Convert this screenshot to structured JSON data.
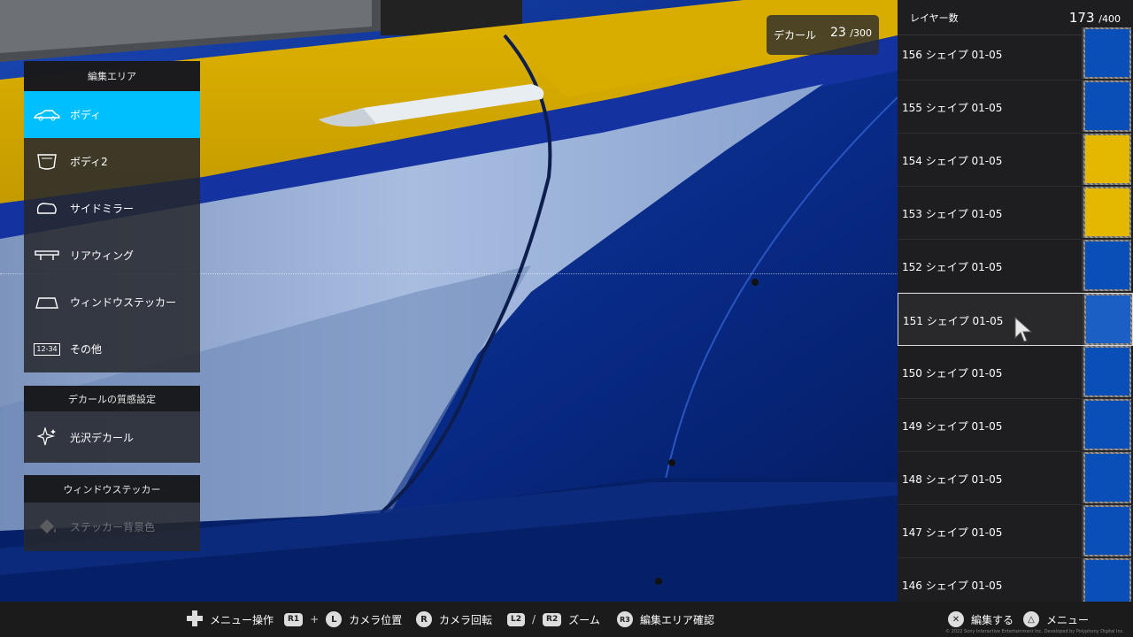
{
  "edit_area": {
    "title": "編集エリア",
    "items": [
      {
        "label": "ボディ",
        "icon": "car-body-icon",
        "active": true
      },
      {
        "label": "ボディ2",
        "icon": "body2-icon"
      },
      {
        "label": "サイドミラー",
        "icon": "side-mirror-icon"
      },
      {
        "label": "リアウィング",
        "icon": "rear-wing-icon"
      },
      {
        "label": "ウィンドウステッカー",
        "icon": "windshield-icon"
      },
      {
        "label": "その他",
        "icon": "license-plate-icon",
        "plate_text": "12-34"
      }
    ]
  },
  "decal_texture": {
    "title": "デカールの質感設定",
    "item": {
      "label": "光沢デカール",
      "icon": "sparkle-icon"
    }
  },
  "window_sticker": {
    "title": "ウィンドウステッカー",
    "item": {
      "label": "ステッカー背景色",
      "icon": "paint-bucket-icon",
      "disabled": true
    }
  },
  "decal_count": {
    "label": "デカール",
    "value": "23",
    "max": "/300"
  },
  "layers": {
    "label": "レイヤー数",
    "count": "173",
    "max": "/400",
    "rows": [
      {
        "name": "156 シェイプ 01-05",
        "color": "#0a4fb8"
      },
      {
        "name": "155 シェイプ 01-05",
        "color": "#0a4fb8"
      },
      {
        "name": "154 シェイプ 01-05",
        "color": "#e5b800"
      },
      {
        "name": "153 シェイプ 01-05",
        "color": "#e5b800"
      },
      {
        "name": "152 シェイプ 01-05",
        "color": "#0a4fb8"
      },
      {
        "name": "151 シェイプ 01-05",
        "color": "#1b5fc4",
        "selected": true
      },
      {
        "name": "150 シェイプ 01-05",
        "color": "#0a4fb8"
      },
      {
        "name": "149 シェイプ 01-05",
        "color": "#0a4fb8"
      },
      {
        "name": "148 シェイプ 01-05",
        "color": "#0a4fb8"
      },
      {
        "name": "147 シェイプ 01-05",
        "color": "#0a4fb8"
      },
      {
        "name": "146 シェイプ 01-05",
        "color": "#0a4fb8"
      }
    ]
  },
  "bottom_bar": {
    "menu_op": "メニュー操作",
    "r1": "R1",
    "plus": "+",
    "l": "L",
    "camera_pos": "カメラ位置",
    "r": "R",
    "camera_rot": "カメラ回転",
    "l2": "L2",
    "slash": "/",
    "r2": "R2",
    "zoom": "ズーム",
    "r3": "R3",
    "edit_area_check": "編集エリア確認",
    "edit": "編集する",
    "menu": "メニュー",
    "copyright": "© 2022 Sony Interactive Entertainment Inc. Developed by Polyphony Digital Inc."
  },
  "colors": {
    "accent": "#00bfff",
    "car_blue": "#0a2f8c",
    "car_yellow": "#e5b800",
    "car_silver": "#9db4d8"
  }
}
